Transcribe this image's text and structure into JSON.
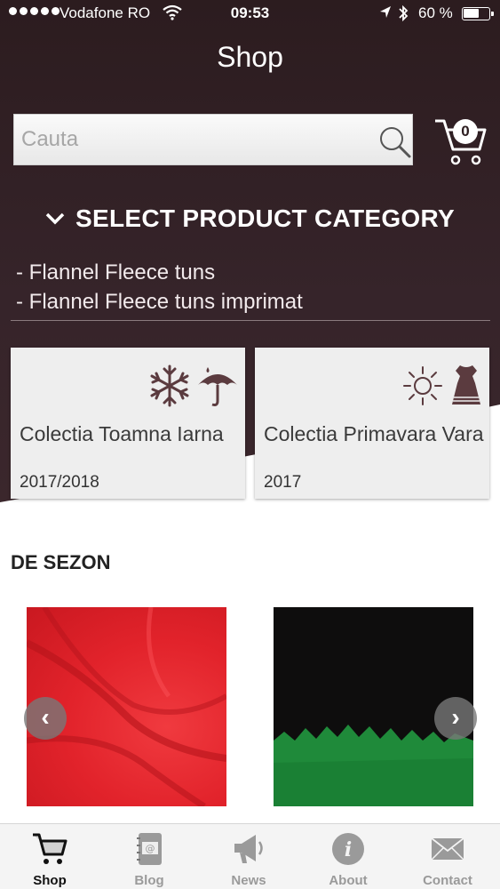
{
  "status_bar": {
    "carrier": "Vodafone RO",
    "time": "09:53",
    "battery": "60 %"
  },
  "header": {
    "title": "Shop"
  },
  "search": {
    "placeholder": "Cauta",
    "value": ""
  },
  "cart": {
    "count": "0"
  },
  "category_toggle": {
    "label": "SELECT PRODUCT CATEGORY"
  },
  "categories": [
    "- Flannel Fleece tuns",
    "- Flannel Fleece tuns imprimat"
  ],
  "collections": [
    {
      "title": "Colectia Toamna Iarna",
      "year": "2017/2018",
      "icons": [
        "snowflake-icon",
        "rain-umbrella-icon"
      ]
    },
    {
      "title": "Colectia Primavara Vara",
      "year": "2017",
      "icons": [
        "sun-icon",
        "dress-icon"
      ]
    }
  ],
  "section": {
    "title": "DE SEZON"
  },
  "carousel": {
    "items": [
      {
        "color": "#e2232b",
        "name": "red-fabric"
      },
      {
        "color": "#0e0d0d",
        "name": "black-green-fabric"
      }
    ],
    "prev_glyph": "‹",
    "next_glyph": "›"
  },
  "tabbar": {
    "tabs": [
      {
        "label": "Shop",
        "icon": "cart-icon",
        "active": true
      },
      {
        "label": "Blog",
        "icon": "notebook-icon",
        "active": false
      },
      {
        "label": "News",
        "icon": "megaphone-icon",
        "active": false
      },
      {
        "label": "About",
        "icon": "info-icon",
        "active": false
      },
      {
        "label": "Contact",
        "icon": "envelope-icon",
        "active": false
      }
    ]
  },
  "colors": {
    "header_bg": "#2c1c1f",
    "accent_icon": "#5b3b3f"
  }
}
